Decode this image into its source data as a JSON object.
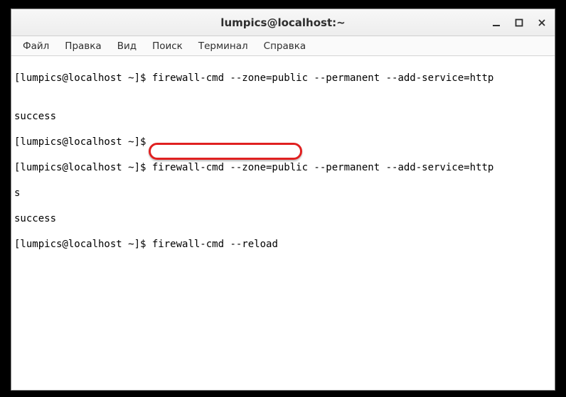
{
  "window": {
    "title": "lumpics@localhost:~"
  },
  "menu": {
    "file": "Файл",
    "edit": "Правка",
    "view": "Вид",
    "search": "Поиск",
    "terminal": "Терминал",
    "help": "Справка"
  },
  "terminal": {
    "line1": "[lumpics@localhost ~]$ firewall-cmd --zone=public --permanent --add-service=http",
    "line2": "",
    "line3": "success",
    "line4": "[lumpics@localhost ~]$",
    "line5": "[lumpics@localhost ~]$ firewall-cmd --zone=public --permanent --add-service=http",
    "line6": "s",
    "line7": "success",
    "line8_prompt": "[lumpics@localhost ~]$ ",
    "line8_cmd": "firewall-cmd --reload"
  },
  "controls": {
    "minimize": "—",
    "maximize": "□",
    "close": "✕"
  }
}
